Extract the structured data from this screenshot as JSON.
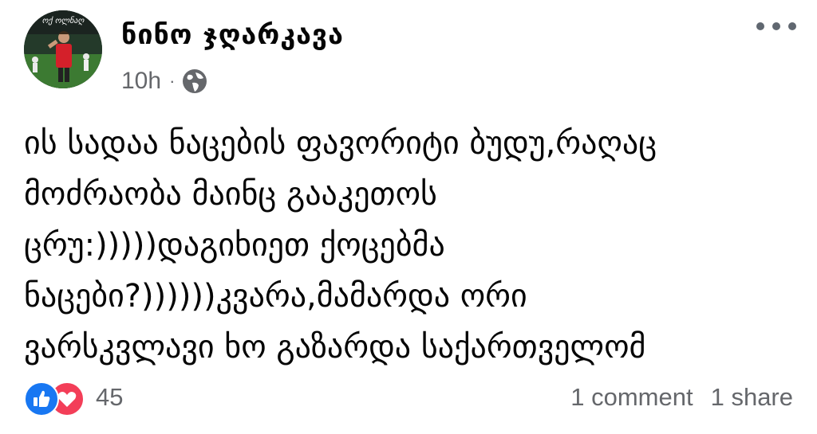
{
  "post": {
    "author": "ნინო ჯღარკავა",
    "time": "10h",
    "separator": "·",
    "audience_icon": "globe-icon",
    "avatar_overlay_text": "ოქ ოლნაღ",
    "text_lines": [
      "ის სადაა ნაცების ფავორიტი ბუდუ,რაღაც",
      "მოძრაობა მაინც გააკეთოს",
      "ცრუ:)))))დაგიხიეთ ქოცებმა",
      "ნაცები?))))))კვარა,მამარდა ორი",
      "ვარსკვლავი ხო გაზარდა საქართველომ"
    ]
  },
  "footer": {
    "reaction_icons": [
      "like-icon",
      "love-icon"
    ],
    "reaction_count": "45",
    "comments": "1 comment",
    "shares": "1 share"
  },
  "colors": {
    "secondary_text": "#65676b",
    "like_blue": "#1877f2",
    "love_red": "#f33e58"
  }
}
